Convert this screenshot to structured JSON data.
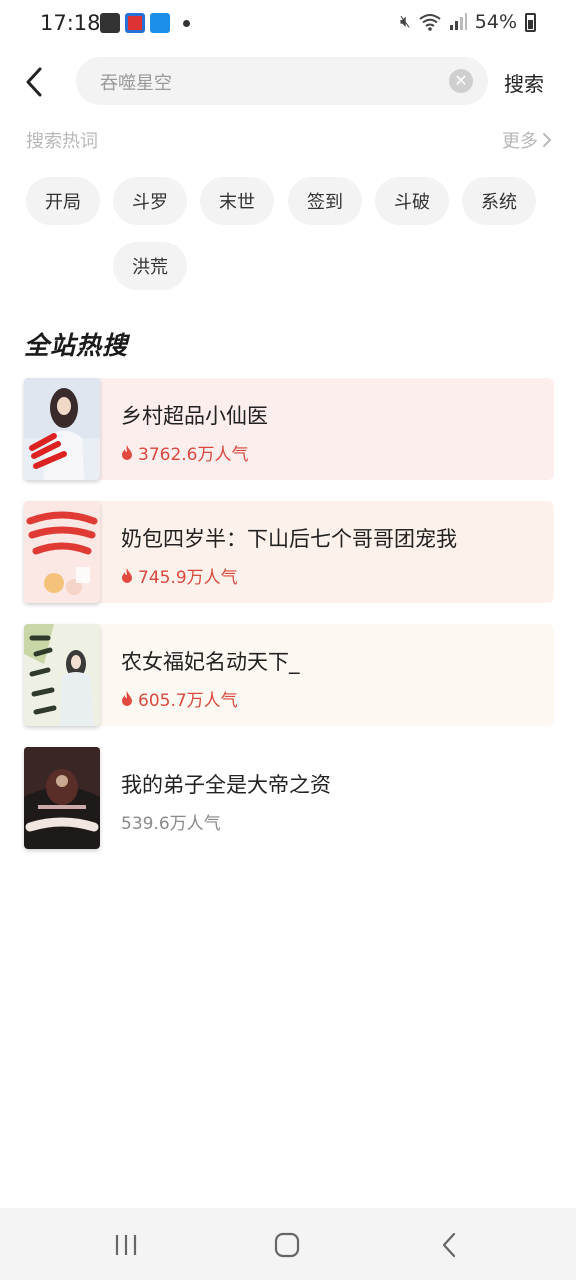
{
  "status_bar": {
    "time": "17:18",
    "battery": "54%"
  },
  "header": {
    "search_value": "吞噬星空",
    "search_button": "搜索"
  },
  "hot_words": {
    "title": "搜索热词",
    "more": "更多",
    "items": [
      "开局",
      "斗罗",
      "末世",
      "签到",
      "斗破",
      "系统",
      "洪荒"
    ]
  },
  "ranking": {
    "title": "全站热搜",
    "items": [
      {
        "title": "乡村超品小仙医",
        "heat": "3762.6万人气",
        "bg": "#fdeeee",
        "heat_color": "#d9493f"
      },
      {
        "title": "奶包四岁半：下山后七个哥哥团宠我",
        "heat": "745.9万人气",
        "bg": "#fdf1eb",
        "heat_color": "#d9493f"
      },
      {
        "title": "农女福妃名动天下_",
        "heat": "605.7万人气",
        "bg": "#fdf8f2",
        "heat_color": "#d9493f"
      },
      {
        "title": "我的弟子全是大帝之资",
        "heat": "539.6万人气",
        "bg": "#ffffff",
        "heat_color": "#8a8a8a"
      }
    ]
  }
}
